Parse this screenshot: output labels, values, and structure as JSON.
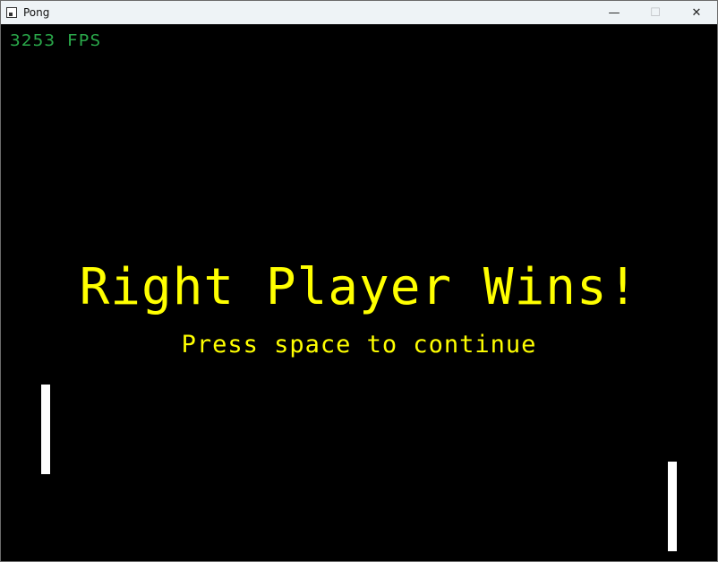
{
  "window": {
    "title": "Pong",
    "minimize_glyph": "—",
    "maximize_glyph": "☐",
    "close_glyph": "✕"
  },
  "hud": {
    "fps_text": "3253 FPS"
  },
  "message": {
    "headline": "Right Player Wins!",
    "prompt": "Press space to continue"
  },
  "colors": {
    "background": "#000000",
    "fps": "#2aa84a",
    "message": "#ffff00",
    "paddle": "#ffffff"
  },
  "icons": {
    "app": "app-window-icon",
    "minimize": "minimize-icon",
    "maximize": "maximize-icon",
    "close": "close-icon"
  }
}
